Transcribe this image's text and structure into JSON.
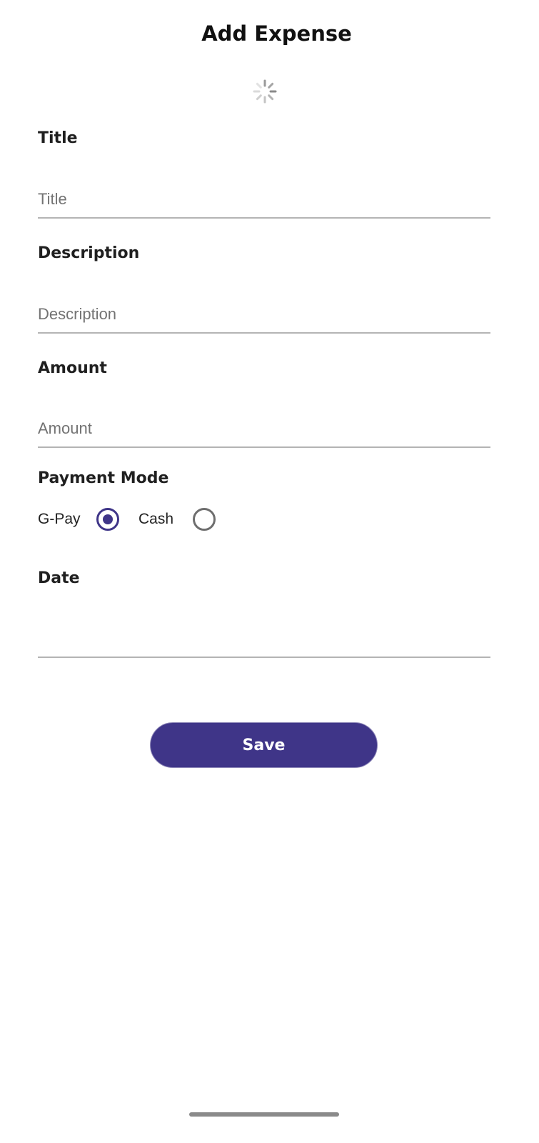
{
  "header": {
    "title": "Add Expense"
  },
  "form": {
    "title_field": {
      "label": "Title",
      "placeholder": "Title",
      "value": ""
    },
    "description_field": {
      "label": "Description",
      "placeholder": "Description",
      "value": ""
    },
    "amount_field": {
      "label": "Amount",
      "placeholder": "Amount",
      "value": ""
    },
    "payment_mode": {
      "label": "Payment Mode",
      "options": [
        {
          "label": "G-Pay",
          "selected": true
        },
        {
          "label": "Cash",
          "selected": false
        }
      ]
    },
    "date_field": {
      "label": "Date",
      "value": ""
    },
    "save_label": "Save"
  },
  "icons": {
    "loading": "loading-spinner-icon"
  },
  "colors": {
    "accent": "#3f3588",
    "underline": "#b4b4b4",
    "placeholder": "#737373"
  }
}
